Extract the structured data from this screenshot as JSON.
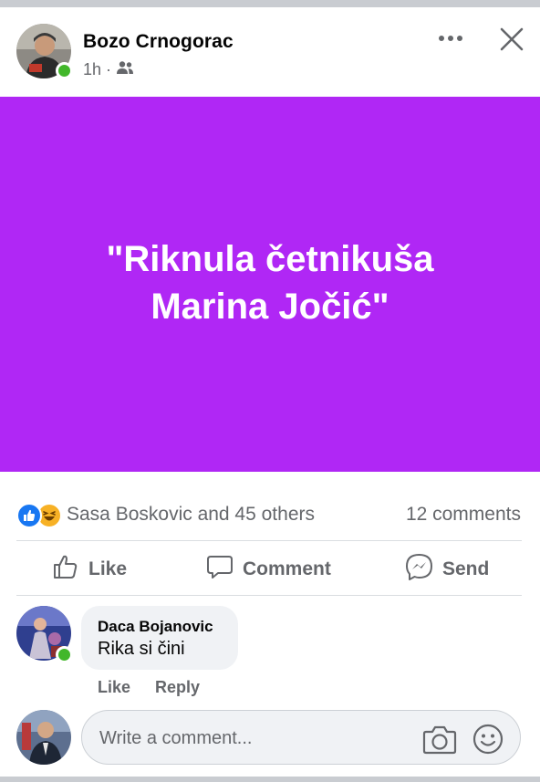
{
  "post": {
    "author": "Bozo Crnogorac",
    "time": "1h",
    "meta_separator": "·",
    "audience_icon": "friends-icon",
    "banner_text": "\"Riknula četnikuša\nMarina Jočić\"",
    "banner_color": "#b027f5"
  },
  "stats": {
    "reactions": [
      "like-reaction-icon",
      "haha-reaction-icon"
    ],
    "reacted_by": "Sasa Boskovic and 45 others",
    "comment_count": "12 comments"
  },
  "actions": {
    "like": "Like",
    "comment": "Comment",
    "send": "Send"
  },
  "comment": {
    "author": "Daca Bojanovic",
    "text": "Rika si čini",
    "like": "Like",
    "reply": "Reply"
  },
  "composer": {
    "placeholder": "Write a comment..."
  },
  "colors": {
    "accent": "#1877f2",
    "online": "#42b72a",
    "secondary_text": "#65676b"
  }
}
